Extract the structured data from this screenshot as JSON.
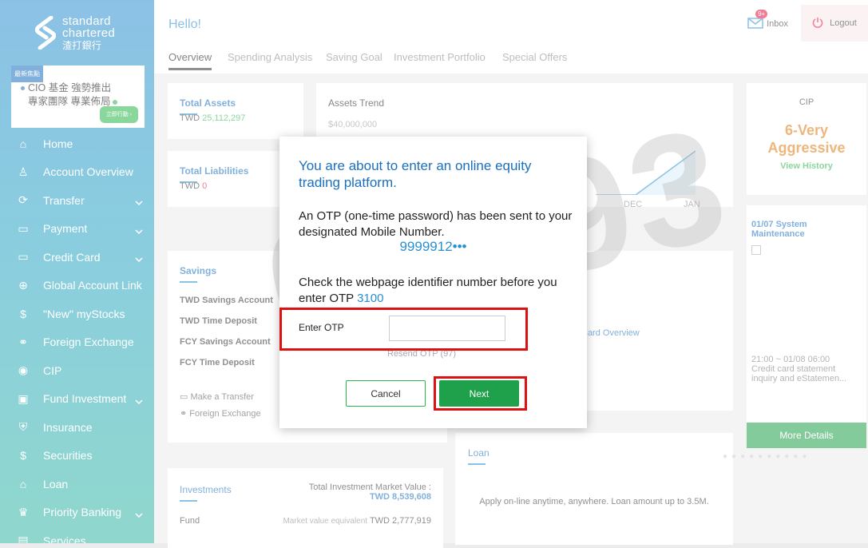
{
  "brand": {
    "name_line1": "standard",
    "name_line2": "chartered",
    "name_zh": "渣打銀行"
  },
  "promo": {
    "tag": "最新焦點",
    "line1": "CIO 基金 強勢推出",
    "line2": "專家團隊 專業佈局",
    "button": "立即行動 ›"
  },
  "sidebar": {
    "items": [
      {
        "label": "Home",
        "icon": "home-icon",
        "chevron": false
      },
      {
        "label": "Account Overview",
        "icon": "person-icon",
        "chevron": false
      },
      {
        "label": "Transfer",
        "icon": "transfer-icon",
        "chevron": true
      },
      {
        "label": "Payment",
        "icon": "payment-icon",
        "chevron": true
      },
      {
        "label": "Credit Card",
        "icon": "credit-card-icon",
        "chevron": true
      },
      {
        "label": "Global Account Link",
        "icon": "globe-icon",
        "chevron": false
      },
      {
        "label": "\"New\" myStocks",
        "icon": "stocks-icon",
        "chevron": false
      },
      {
        "label": "Foreign Exchange",
        "icon": "exchange-icon",
        "chevron": false
      },
      {
        "label": "CIP",
        "icon": "cip-icon",
        "chevron": false
      },
      {
        "label": "Fund Investment",
        "icon": "fund-icon",
        "chevron": true
      },
      {
        "label": "Insurance",
        "icon": "insurance-icon",
        "chevron": false
      },
      {
        "label": "Securities",
        "icon": "securities-icon",
        "chevron": false
      },
      {
        "label": "Loan",
        "icon": "loan-icon",
        "chevron": false
      },
      {
        "label": "Priority Banking",
        "icon": "priority-icon",
        "chevron": true
      },
      {
        "label": "Services",
        "icon": "services-icon",
        "chevron": false
      }
    ]
  },
  "header": {
    "greeting": "Hello!",
    "inbox_label": "Inbox",
    "inbox_badge": "9+",
    "logout_label": "Logout"
  },
  "tabs": [
    "Overview",
    "Spending Analysis",
    "Saving Goal",
    "Investment Portfolio",
    "Special Offers"
  ],
  "total_assets": {
    "title": "Total Assets",
    "currency": "TWD",
    "value": "25,112,297"
  },
  "total_liabilities": {
    "title": "Total Liabilities",
    "currency": "TWD",
    "value": "0"
  },
  "assets_trend": {
    "title": "Assets Trend",
    "y_label": "$40,000,000",
    "x_labels": [
      "DEC",
      "JAN"
    ]
  },
  "cip": {
    "title": "CIP",
    "level": "6-Very Aggressive",
    "link": "View History"
  },
  "notice": {
    "title": "01/07 System Maintenance",
    "time": "21:00 ~ 01/08 06:00",
    "desc": "Credit card statement inquiry and eStatemen...",
    "button": "More Details"
  },
  "savings": {
    "title": "Savings",
    "rows": [
      "TWD Savings Account",
      "TWD Time Deposit",
      "FCY Savings Account",
      "FCY Time Deposit"
    ],
    "link1": "Make a Transfer",
    "link2": "Foreign Exchange"
  },
  "card_overview": "Card Overview",
  "loan": {
    "title": "Loan",
    "desc": "Apply on-line anytime, anywhere. Loan amount up to 3.5M."
  },
  "investments": {
    "title": "Investments",
    "total_label": "Total Investment Market Value :",
    "total_value": "TWD 8,539,608",
    "row_label": "Fund",
    "row_note": "Market value equivalent",
    "row_value": "TWD 2,777,919"
  },
  "watermark": "01293",
  "modal": {
    "title": "You are about to enter an online equity trading platform.",
    "body": "An OTP (one-time password) has been sent to your designated Mobile Number.",
    "phone": "9999912•••",
    "check_text": "Check the webpage identifier number before you enter OTP",
    "code": "3100",
    "otp_label": "Enter OTP",
    "otp_value": "",
    "resend": "Resend OTP (97)",
    "cancel": "Cancel",
    "next": "Next"
  },
  "colors": {
    "accent_blue": "#2a8fcf",
    "green": "#2bb64a",
    "highlight_red": "#dd1111"
  }
}
